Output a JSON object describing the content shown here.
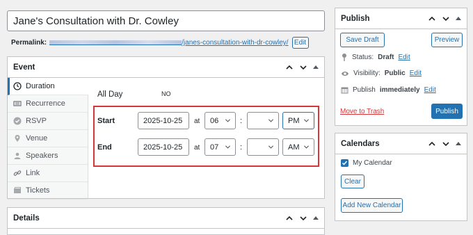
{
  "post": {
    "title": "Jane's Consultation with Dr. Cowley",
    "permalink_label": "Permalink:",
    "permalink_slug": "/janes-consultation-with-dr-cowley/",
    "edit_label": "Edit"
  },
  "event_box": {
    "title": "Event",
    "tabs": [
      {
        "label": "Duration",
        "icon": "clock-icon"
      },
      {
        "label": "Recurrence",
        "icon": "recurrence-icon"
      },
      {
        "label": "RSVP",
        "icon": "check-circle-icon"
      },
      {
        "label": "Venue",
        "icon": "location-pin-icon"
      },
      {
        "label": "Speakers",
        "icon": "speakers-icon"
      },
      {
        "label": "Link",
        "icon": "link-icon"
      },
      {
        "label": "Tickets",
        "icon": "tickets-icon"
      }
    ],
    "all_day_label": "All Day",
    "all_day_state": "NO",
    "start": {
      "label": "Start",
      "date": "2025-10-25",
      "at": "at",
      "hour": "06",
      "colon": ":",
      "minute": "",
      "ampm": "PM"
    },
    "end": {
      "label": "End",
      "date": "2025-10-25",
      "at": "at",
      "hour": "07",
      "colon": ":",
      "minute": "",
      "ampm": "AM"
    }
  },
  "details_box": {
    "title": "Details"
  },
  "publish_box": {
    "title": "Publish",
    "save_draft": "Save Draft",
    "preview": "Preview",
    "status_label": "Status:",
    "status_value": "Draft",
    "visibility_label": "Visibility:",
    "visibility_value": "Public",
    "publish_label": "Publish",
    "publish_value": "immediately",
    "edit": "Edit",
    "trash": "Move to Trash",
    "publish_button": "Publish"
  },
  "calendars_box": {
    "title": "Calendars",
    "calendar_name": "My Calendar",
    "clear": "Clear",
    "add_new": "Add New Calendar"
  },
  "colors": {
    "accent": "#2271b1",
    "danger": "#d63638"
  }
}
